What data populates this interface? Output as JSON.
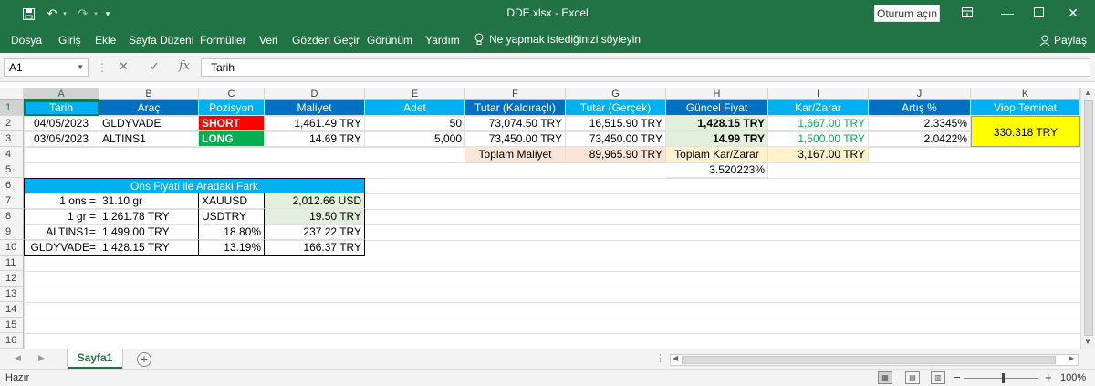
{
  "window": {
    "title": "DDE.xlsx  -  Excel",
    "signin_label": "Oturum açın",
    "icons": [
      "save-icon",
      "undo-icon",
      "redo-icon",
      "customize-qat-icon",
      "ribbon-display-icon",
      "minimize-icon",
      "maximize-icon",
      "close-icon"
    ]
  },
  "ribbon": {
    "tabs": [
      "Dosya",
      "Giriş",
      "Ekle",
      "Sayfa Düzeni",
      "Formüller",
      "Veri",
      "Gözden Geçir",
      "Görünüm",
      "Yardım"
    ],
    "tell_me": "Ne yapmak istediğinizi söyleyin",
    "share": "Paylaş"
  },
  "formula_bar": {
    "name_box": "A1",
    "content": "Tarih"
  },
  "columns": [
    "A",
    "B",
    "C",
    "D",
    "E",
    "F",
    "G",
    "H",
    "I",
    "J",
    "K"
  ],
  "rows": [
    "1",
    "2",
    "3",
    "4",
    "5",
    "6",
    "7",
    "8",
    "9",
    "10",
    "11",
    "12",
    "13",
    "14",
    "15",
    "16"
  ],
  "sheet": {
    "headers": {
      "A": "Tarih",
      "B": "Araç",
      "C": "Pozisyon",
      "D": "Maliyet",
      "E": "Adet",
      "F": "Tutar (Kaldıraçlı)",
      "G": "Tutar (Gerçek)",
      "H": "Güncel Fiyat",
      "I": "Kar/Zarar",
      "J": "Artış %",
      "K": "Viop Teminat"
    },
    "trades": [
      {
        "date": "04/05/2023",
        "instrument": "GLDYVADE",
        "position": "SHORT",
        "cost": "1,461.49 TRY",
        "qty": "50",
        "amount_leveraged": "73,074.50 TRY",
        "amount_real": "16,515.90 TRY",
        "current_price": "1,428.15 TRY",
        "pnl": "1,667.00 TRY",
        "change_pct": "2.3345%"
      },
      {
        "date": "03/05/2023",
        "instrument": "ALTINS1",
        "position": "LONG",
        "cost": "14.69 TRY",
        "qty": "5,000",
        "amount_leveraged": "73,450.00 TRY",
        "amount_real": "73,450.00 TRY",
        "current_price": "14.99 TRY",
        "pnl": "1,500.00 TRY",
        "change_pct": "2.0422%"
      }
    ],
    "viop_collateral": "330.318 TRY",
    "totals": {
      "total_cost_label": "Toplam Maliyet",
      "total_cost": "89,965.90 TRY",
      "total_pnl_label": "Toplam Kar/Zarar",
      "total_pnl": "3,167.00 TRY",
      "total_pct": "3.520223%"
    },
    "ons": {
      "title": "Ons Fiyati ile Aradaki Fark",
      "rows": [
        {
          "a": "1 ons =",
          "b": "31.10 gr",
          "c": "XAUUSD",
          "d": "2,012.66 USD"
        },
        {
          "a": "1 gr =",
          "b": "1,261.78 TRY",
          "c": "USDTRY",
          "d": "19.50 TRY"
        },
        {
          "a": "ALTINS1=",
          "b": "1,499.00 TRY",
          "c": "18.80%",
          "d": "237.22 TRY"
        },
        {
          "a": "GLDYVADE=",
          "b": "1,428.15 TRY",
          "c": "13.19%",
          "d": "166.37 TRY"
        }
      ]
    }
  },
  "sheet_tabs": [
    "Sayfa1"
  ],
  "status": {
    "ready": "Hazır",
    "zoom": "100%"
  }
}
